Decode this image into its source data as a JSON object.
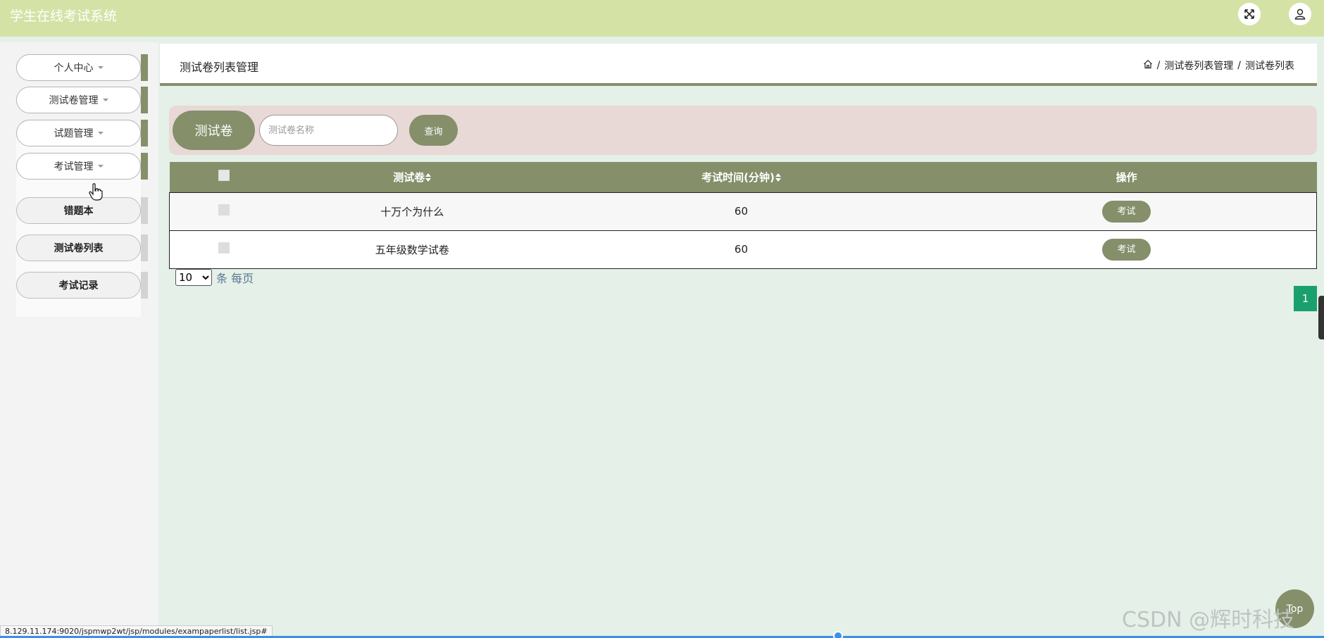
{
  "header": {
    "app_title": "学生在线考试系统",
    "fullscreen_icon": "expand-icon",
    "user_icon": "user-icon"
  },
  "sidebar": {
    "menus": [
      {
        "label": "个人中心"
      },
      {
        "label": "测试卷管理"
      },
      {
        "label": "试题管理"
      },
      {
        "label": "考试管理"
      }
    ],
    "submenu": [
      {
        "label": "错题本"
      },
      {
        "label": "测试卷列表"
      },
      {
        "label": "考试记录"
      }
    ]
  },
  "page": {
    "title": "测试卷列表管理",
    "breadcrumb": {
      "home_icon": "home-icon",
      "sep": "/",
      "level1": "测试卷列表管理",
      "level2": "测试卷列表"
    }
  },
  "search": {
    "label": "测试卷",
    "placeholder": "测试卷名称",
    "value": "",
    "button": "查询"
  },
  "table": {
    "columns": [
      "",
      "测试卷",
      "考试时间(分钟)",
      "操作"
    ],
    "rows": [
      {
        "name": "十万个为什么",
        "minutes": "60",
        "action": "考试"
      },
      {
        "name": "五年级数学试卷",
        "minutes": "60",
        "action": "考试"
      }
    ]
  },
  "pager": {
    "page_size": "10",
    "page_size_options": [
      "10"
    ],
    "suffix": "条 每页",
    "current_page": "1"
  },
  "status_bar": {
    "url": "8.129.11.174:9020/jspmwp2wt/jsp/modules/exampaperlist/list.jsp#"
  },
  "watermark": "CSDN @辉时科技",
  "floating_button": "Top",
  "colors": {
    "header_bg": "#d4e2a6",
    "accent": "#858f6a",
    "main_bg": "#e4f0e8",
    "search_panel_bg": "#e8d9d6",
    "page_active": "#1aa06d"
  }
}
